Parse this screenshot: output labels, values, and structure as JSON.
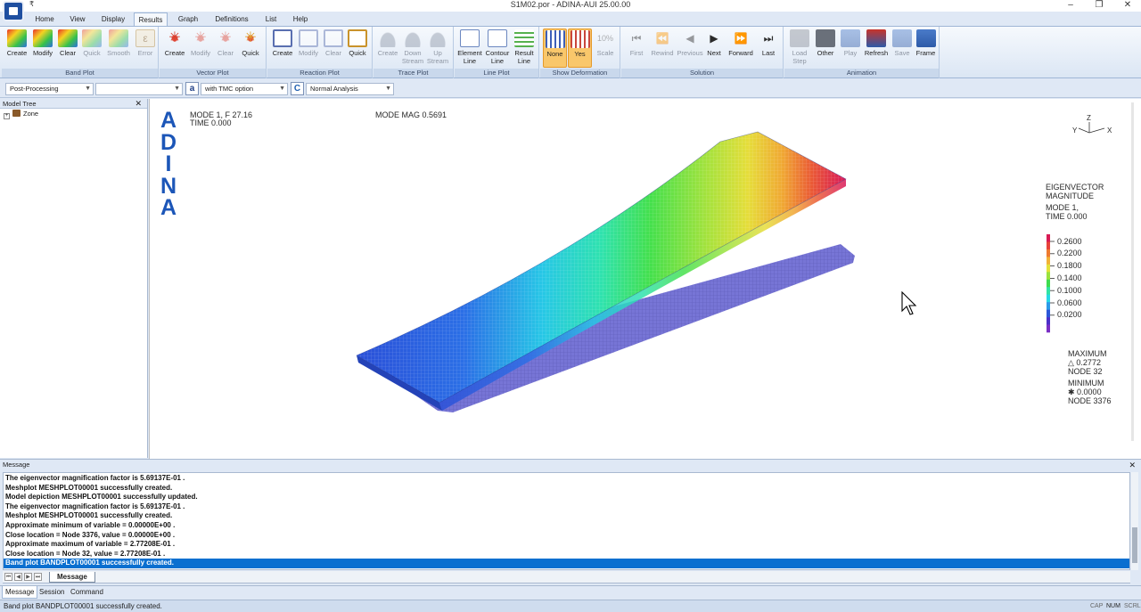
{
  "window": {
    "title": "S1M02.por - ADINA-AUI 25.00.00",
    "qat": "₹"
  },
  "tabs": [
    "Home",
    "View",
    "Display",
    "Results",
    "Graph",
    "Definitions",
    "List",
    "Help"
  ],
  "ribbon": {
    "band_plot": {
      "title": "Band Plot",
      "buttons": [
        "Create",
        "Modify",
        "Clear",
        "Quick",
        "Smooth",
        "Error"
      ]
    },
    "vector_plot": {
      "title": "Vector Plot",
      "buttons": [
        "Create",
        "Modify",
        "Clear",
        "Quick"
      ]
    },
    "reaction_plot": {
      "title": "Reaction Plot",
      "buttons": [
        "Create",
        "Modify",
        "Clear",
        "Quick"
      ]
    },
    "trace_plot": {
      "title": "Trace Plot",
      "buttons": [
        "Create",
        "Down Stream",
        "Up Stream"
      ]
    },
    "line_plot": {
      "title": "Line Plot",
      "buttons": [
        "Element Line",
        "Contour Line",
        "Result Line"
      ]
    },
    "show_deformation": {
      "title": "Show Deformation",
      "buttons": [
        "None",
        "Yes",
        "Scale"
      ],
      "scale_value": "10%"
    },
    "solution": {
      "title": "Solution",
      "buttons": [
        "First",
        "Rewind",
        "Previous",
        "Next",
        "Forward",
        "Last"
      ]
    },
    "animation": {
      "title": "Animation",
      "buttons": [
        "Load Step",
        "Other",
        "Play",
        "Refresh",
        "Save",
        "Frame"
      ]
    }
  },
  "toolbar": {
    "mode": "Post-Processing",
    "blank": "",
    "tmc": "with TMC option",
    "analysis": "Normal Analysis",
    "a_icon": "a",
    "c_icon": "C"
  },
  "model_tree": {
    "title": "Model Tree",
    "items": [
      "Zone"
    ]
  },
  "viewport": {
    "logo": [
      "A",
      "D",
      "I",
      "N",
      "A"
    ],
    "mode_line": "MODE 1, F 27.16",
    "time_line": "TIME 0.000",
    "mode_mag": "MODE MAG 0.5691",
    "axes": {
      "z": "Z",
      "y": "Y",
      "x": "X"
    },
    "legend": {
      "title1": "EIGENVECTOR",
      "title2": "MAGNITUDE",
      "mode": "MODE 1,",
      "time": "TIME 0.000",
      "ticks": [
        "0.2600",
        "0.2200",
        "0.1800",
        "0.1400",
        "0.1000",
        "0.0600",
        "0.0200"
      ],
      "colors": [
        "#d81b55",
        "#e7433a",
        "#ee7a30",
        "#f2b237",
        "#e4e23a",
        "#9be23e",
        "#3fdc4e",
        "#32e3a4",
        "#27d8e6",
        "#2c9ae8",
        "#2b57d8",
        "#4b2fc8",
        "#7a2ec4"
      ]
    },
    "maxmin": {
      "max_label": "MAXIMUM",
      "max_val": "△ 0.2772",
      "max_node": "NODE 32",
      "min_label": "MINIMUM",
      "min_val": "✱ 0.0000",
      "min_node": "NODE 3376"
    }
  },
  "message": {
    "title": "Message",
    "lines": [
      " The eigenvector magnification factor is  5.69137E-01 .",
      " Meshplot MESHPLOT00001 successfully created.",
      "Model depiction MESHPLOT00001 successfully updated.",
      " The eigenvector magnification factor is  5.69137E-01 .",
      " Meshplot MESHPLOT00001 successfully created.",
      "Approximate minimum of variable =  0.00000E+00 .",
      " Close location = Node 3376, value =  0.00000E+00 .",
      " Approximate maximum of variable =  2.77208E-01 .",
      " Close location = Node 32, value =  2.77208E-01 .",
      " Band plot BANDPLOT00001 successfully created."
    ],
    "sheet_tab": "Message"
  },
  "bottom_tabs": [
    "Message",
    "Session",
    "Command"
  ],
  "status": {
    "text": "Band plot BANDPLOT00001 successfully created.",
    "cap": "CAP",
    "num": "NUM",
    "scrl": "SCRL"
  }
}
